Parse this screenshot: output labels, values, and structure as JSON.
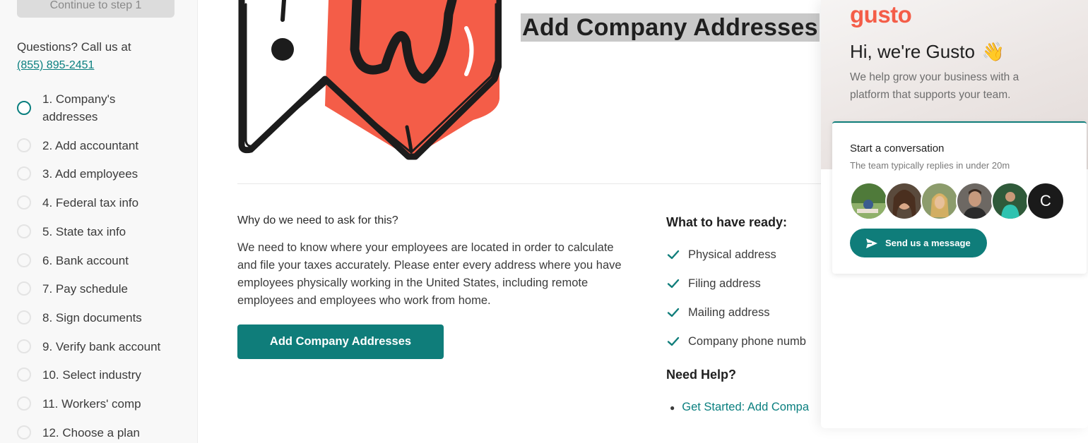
{
  "sidebar": {
    "continue_label": "Continue to step 1",
    "questions_text": "Questions? Call us at",
    "phone": "(855) 895-2451",
    "steps": [
      {
        "label": "1. Company's addresses",
        "state": "active"
      },
      {
        "label": "2. Add accountant",
        "state": "pending"
      },
      {
        "label": "3. Add employees",
        "state": "pending"
      },
      {
        "label": "4. Federal tax info",
        "state": "pending"
      },
      {
        "label": "5. State tax info",
        "state": "pending"
      },
      {
        "label": "6. Bank account",
        "state": "pending"
      },
      {
        "label": "7. Pay schedule",
        "state": "pending"
      },
      {
        "label": "8. Sign documents",
        "state": "pending"
      },
      {
        "label": "9. Verify bank account",
        "state": "pending"
      },
      {
        "label": "10. Select industry",
        "state": "pending"
      },
      {
        "label": "11. Workers' comp",
        "state": "pending"
      },
      {
        "label": "12. Choose a plan",
        "state": "pending"
      }
    ]
  },
  "main": {
    "title": "Add Company Addresses",
    "why_heading": "Why do we need to ask for this?",
    "why_body": "We need to know where your employees are located in order to calculate and file your taxes accurately. Please enter every address where you have employees physically working in the United States, including remote employees and employees who work from home.",
    "add_button": "Add Company Addresses",
    "ready_heading": "What to have ready:",
    "ready_items": [
      "Physical address",
      "Filing address",
      "Mailing address",
      "Company phone numb"
    ],
    "help_heading": "Need Help?",
    "help_link": "Get Started: Add Compa"
  },
  "chat": {
    "logo": "gusto",
    "greeting": "Hi, we're Gusto",
    "wave_icon": "👋",
    "tagline": "We help grow your business with a platform that supports your team.",
    "convo_title": "Start a conversation",
    "convo_sub": "The team typically replies in under 20m",
    "avatar_initial": "C",
    "send_label": "Send us a message"
  },
  "colors": {
    "accent": "#0f7d7a",
    "brand": "#f45d48",
    "title_highlight": "#c9c9c9"
  }
}
